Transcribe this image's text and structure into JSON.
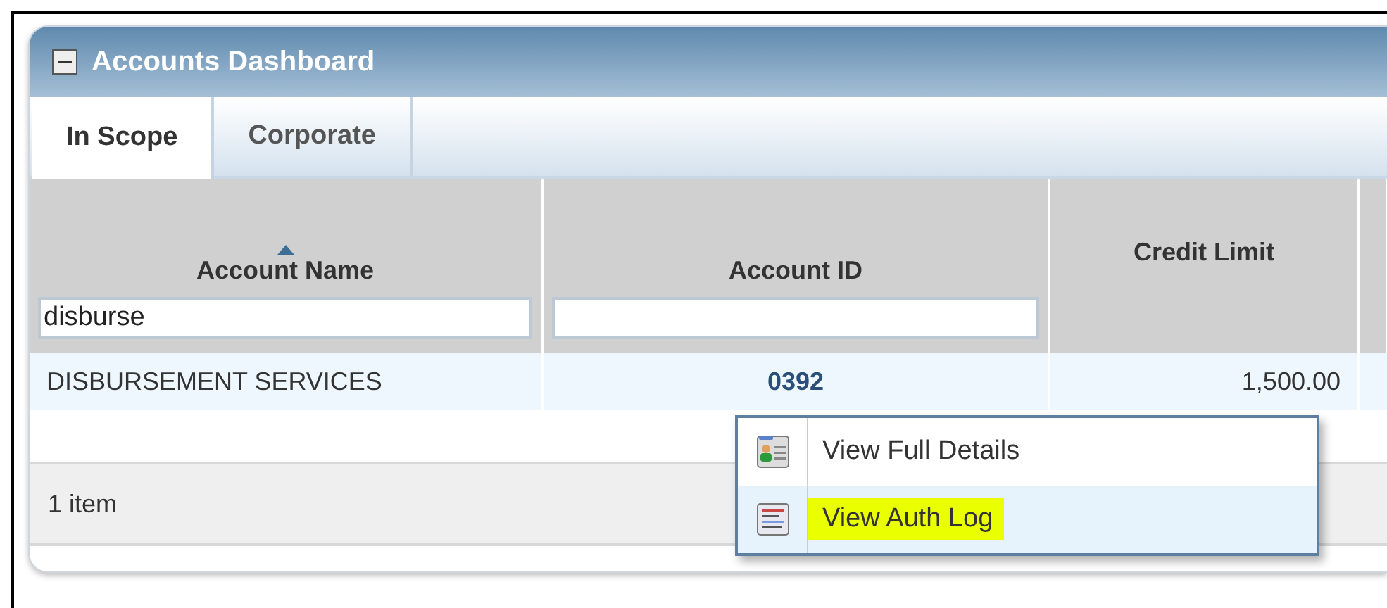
{
  "panel": {
    "title": "Accounts Dashboard",
    "collapsed": false
  },
  "tabs": [
    {
      "label": "In Scope",
      "selected": true
    },
    {
      "label": "Corporate",
      "selected": false
    }
  ],
  "table": {
    "columns": [
      {
        "label": "Account Name",
        "sorted": true,
        "filter_field": true,
        "filter": "disburse"
      },
      {
        "label": "Account ID",
        "sorted": false,
        "filter_field": true
      },
      {
        "label": "Credit Limit",
        "sorted": false,
        "filter_field": false
      }
    ],
    "rows": [
      {
        "cells": [
          "DISBURSEMENT SERVICES",
          "0392",
          "1,500.00"
        ]
      }
    ]
  },
  "footer": {
    "count": "1 item"
  },
  "context_menu": {
    "items": [
      {
        "label": "View Full Details",
        "hovered": false,
        "marked": false
      },
      {
        "label": "View Auth Log",
        "hovered": true,
        "marked": true
      }
    ]
  }
}
